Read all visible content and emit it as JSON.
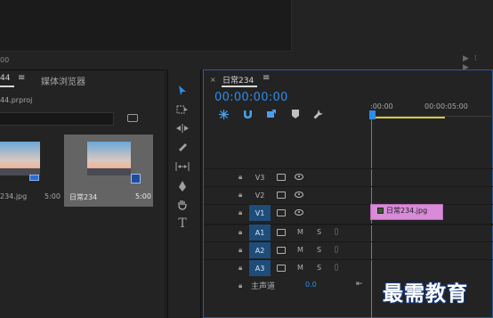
{
  "source_monitor": {
    "timecode_left": "00",
    "controls_right": "▶⁞ ▶"
  },
  "project_panel": {
    "tab_name": "44",
    "tab_menu": "≡",
    "media_browser_tab": "媒体浏览器",
    "project_file": "44.prproj",
    "items": [
      {
        "name": "234.jpg",
        "duration": "5:00"
      },
      {
        "name": "日常234",
        "duration": "5:00"
      }
    ]
  },
  "tools": {
    "icons": [
      "selection-tool",
      "track-select-tool",
      "ripple-edit-tool",
      "razor-tool",
      "slip-tool",
      "pen-tool",
      "hand-tool",
      "type-tool"
    ]
  },
  "timeline": {
    "close": "×",
    "title": "日常234",
    "menu": "≡",
    "timecode": "00:00:00:00",
    "ruler": {
      "left": ":00:00",
      "mid": "00:00:05:00"
    },
    "video_tracks": [
      "V3",
      "V2",
      "V1"
    ],
    "audio_tracks": [
      "A1",
      "A2",
      "A3"
    ],
    "mute_label": "M",
    "solo_label": "S",
    "clip": {
      "name": "日常234.jpg"
    },
    "master": {
      "label": "主声道",
      "value": "0.0",
      "end_icon": "⇤"
    }
  },
  "watermark": "最需教育",
  "colors": {
    "accent": "#2d8ceb",
    "clip": "#d98ad8",
    "track_on": "#1e4d7a",
    "work_area": "#d8c83a"
  }
}
